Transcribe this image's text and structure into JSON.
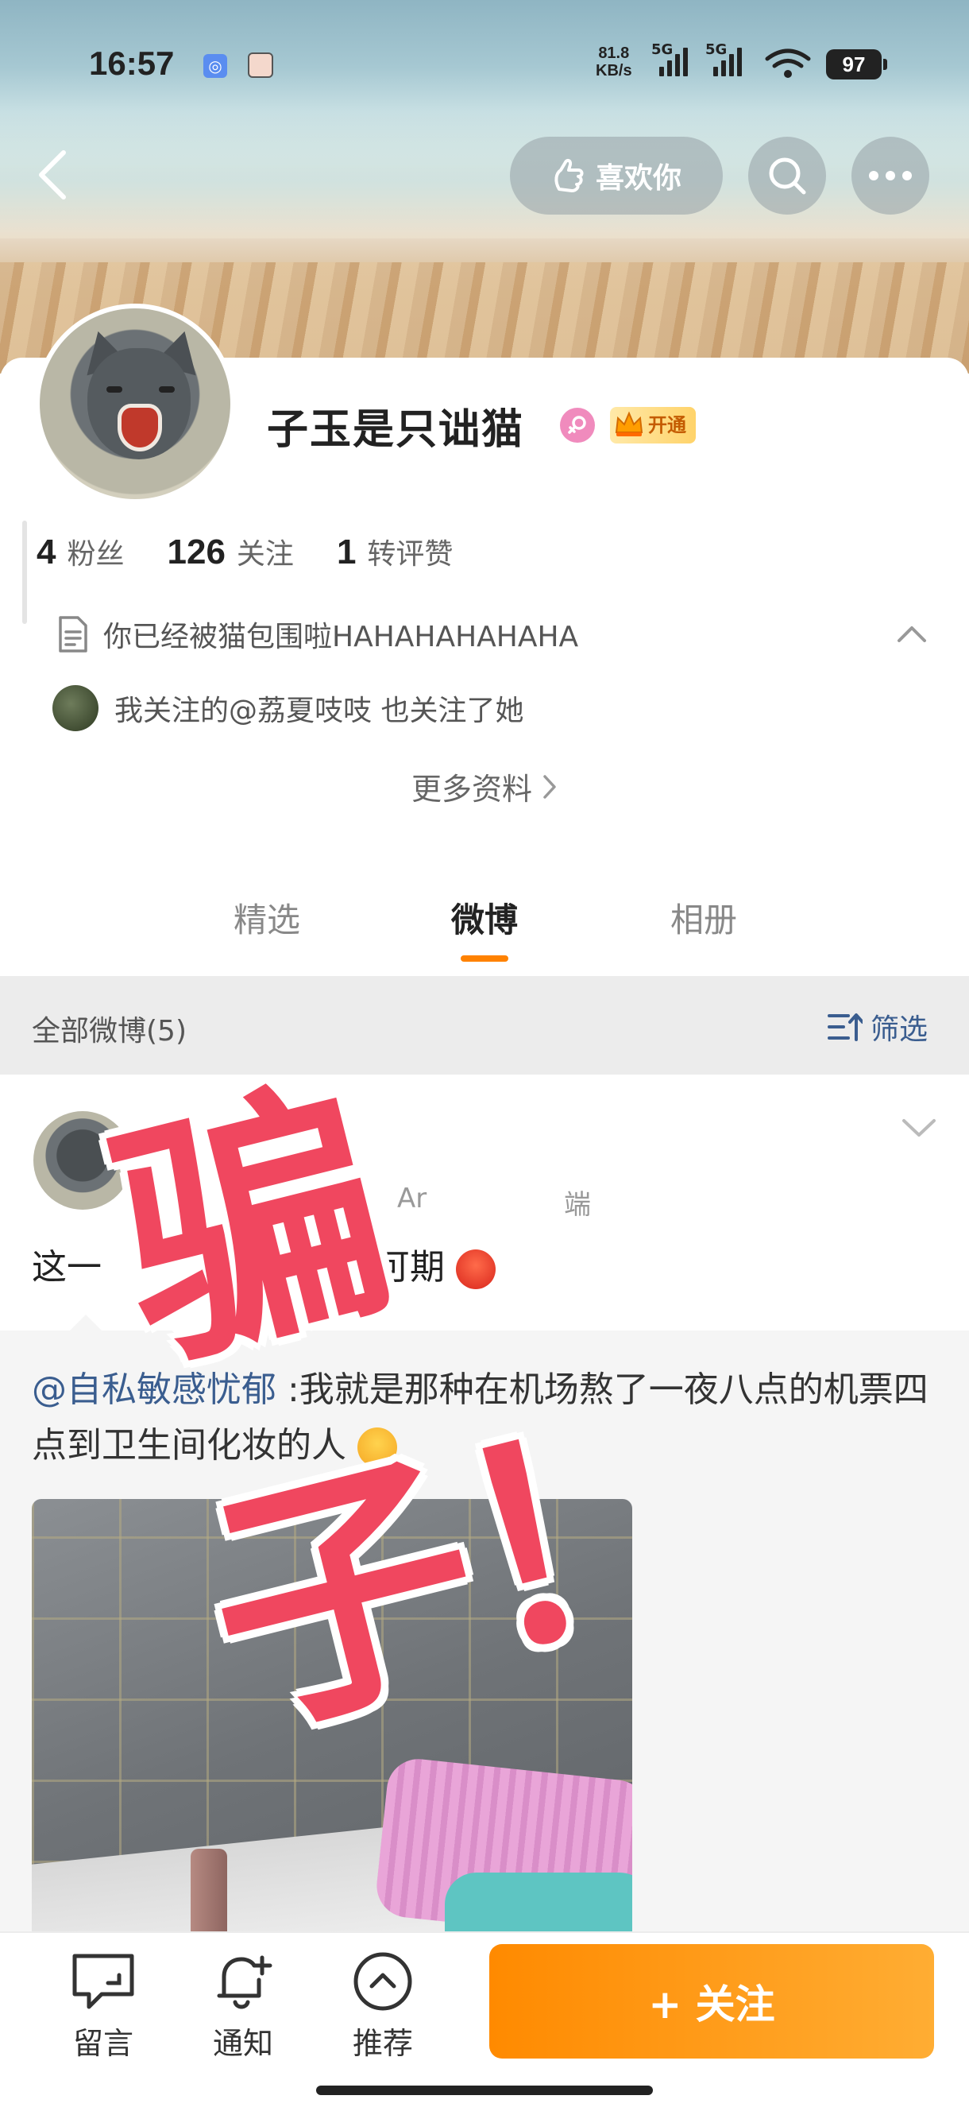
{
  "status_bar": {
    "time": "16:57",
    "net_speed_value": "81.8",
    "net_speed_unit": "KB/s",
    "sim1_label": "5G",
    "sim2_label": "5G",
    "battery": "97"
  },
  "header": {
    "like_label": "喜欢你"
  },
  "profile": {
    "username": "子玉是只诎猫",
    "vip_label": "开通",
    "stats": [
      {
        "value": "4",
        "label": "粉丝"
      },
      {
        "value": "126",
        "label": "关注"
      },
      {
        "value": "1",
        "label": "转评赞"
      }
    ],
    "bio": "你已经被猫包围啦HAHAHAHAHAHA",
    "mutual_follow": "我关注的@荔夏吱吱 也关注了她",
    "more_info": "更多资料"
  },
  "tabs": [
    {
      "label": "精选",
      "active": false
    },
    {
      "label": "微博",
      "active": true
    },
    {
      "label": "相册",
      "active": false
    }
  ],
  "feed": {
    "count_label": "全部微博(5)",
    "filter_label": "筛选"
  },
  "post": {
    "meta_partial_left": "Ar",
    "meta_partial_right": "端",
    "text_start": "这一",
    "text_end": "来可期",
    "repost": {
      "mention": "@自私敏感忧郁",
      "text": " :我就是那种在机场熬了一夜八点的机票四点到卫生间化妆的人"
    }
  },
  "watermark": {
    "text": "骗子！"
  },
  "bottom_bar": {
    "comment_label": "留言",
    "notify_label": "通知",
    "recommend_label": "推荐",
    "follow_label": "+ 关注"
  },
  "colors": {
    "accent": "#ff8200",
    "link": "#3a5d8f",
    "watermark": "#f0475f"
  }
}
